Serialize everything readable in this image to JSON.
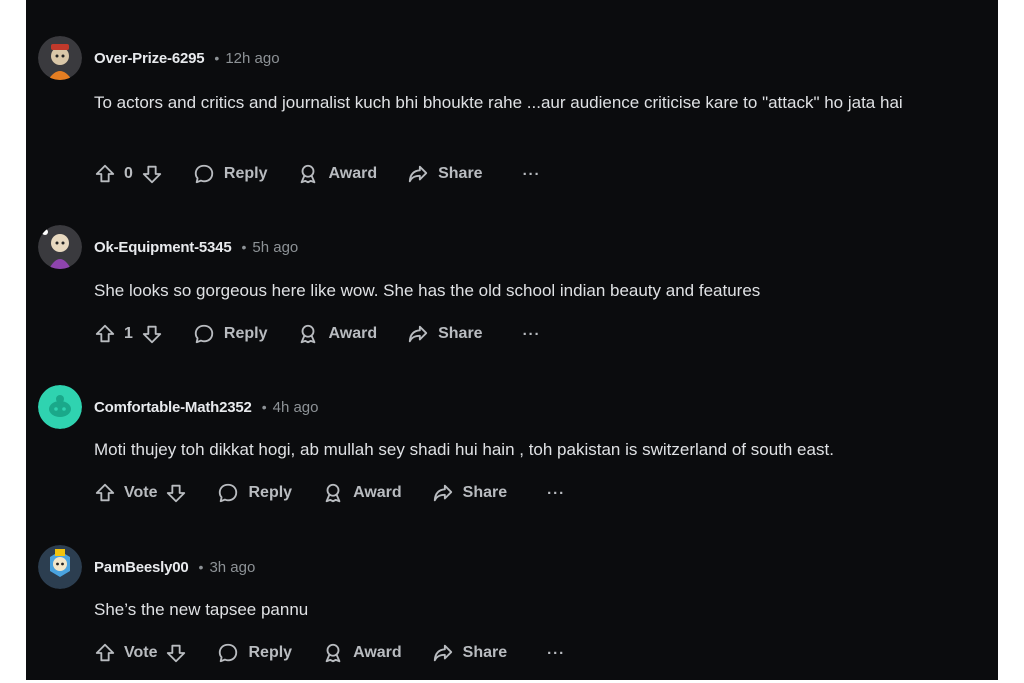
{
  "comments": [
    {
      "username": "Over-Prize-6295",
      "time": "12h ago",
      "body": "To actors and critics and journalist kuch bhi bhoukte rahe ...aur audience criticise kare to \"attack\" ho jata hai",
      "vote_label": "0",
      "reply_label": "Reply",
      "award_label": "Award",
      "share_label": "Share",
      "more_label": "···"
    },
    {
      "username": "Ok-Equipment-5345",
      "time": "5h ago",
      "body": "She looks so gorgeous here like wow. She has the old school indian beauty and features",
      "vote_label": "1",
      "reply_label": "Reply",
      "award_label": "Award",
      "share_label": "Share",
      "more_label": "···"
    },
    {
      "username": "Comfortable-Math2352",
      "time": "4h ago",
      "body": "Moti thujey toh dikkat hogi, ab mullah sey shadi hui hain , toh pakistan is switzerland of south east.",
      "vote_label": "Vote",
      "reply_label": "Reply",
      "award_label": "Award",
      "share_label": "Share",
      "more_label": "···"
    },
    {
      "username": "PamBeesly00",
      "time": "3h ago",
      "body": "She’s the new tapsee pannu",
      "vote_label": "Vote",
      "reply_label": "Reply",
      "award_label": "Award",
      "share_label": "Share",
      "more_label": "···"
    }
  ],
  "colors": {
    "background": "#0b0c0e",
    "text": "#dfe1e4",
    "muted": "#8d9296",
    "avatar_teal": "#2fd3b0"
  },
  "icons": [
    "upvote-icon",
    "downvote-icon",
    "reply-icon",
    "award-icon",
    "share-icon",
    "more-icon"
  ]
}
